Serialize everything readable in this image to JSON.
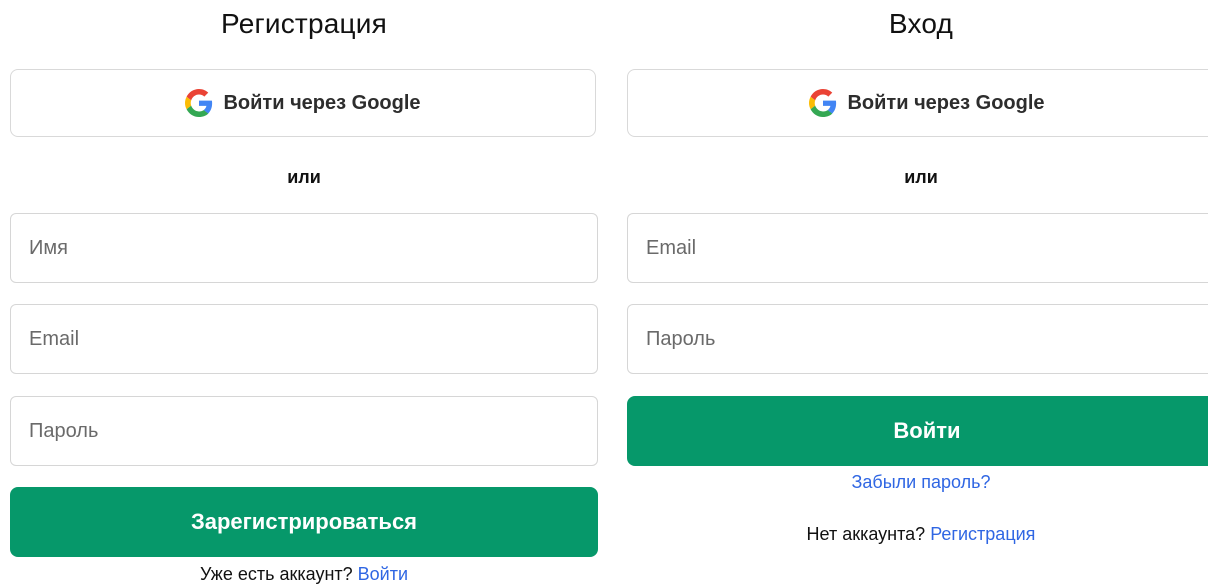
{
  "register": {
    "title": "Регистрация",
    "google_label": "Войти через Google",
    "or_label": "или",
    "fields": {
      "name": {
        "placeholder": "Имя"
      },
      "email": {
        "placeholder": "Email"
      },
      "password": {
        "placeholder": "Пароль"
      }
    },
    "submit_label": "Зарегистрироваться",
    "footer_text": "Уже есть аккаунт?",
    "footer_link": "Войти"
  },
  "login": {
    "title": "Вход",
    "google_label": "Войти через Google",
    "or_label": "или",
    "fields": {
      "email": {
        "placeholder": "Email"
      },
      "password": {
        "placeholder": "Пароль"
      }
    },
    "submit_label": "Войти",
    "forgot_link": "Забыли пароль?",
    "footer_text": "Нет аккаунта?",
    "footer_link": "Регистрация"
  },
  "colors": {
    "primary": "#06986a",
    "link": "#2f66e3",
    "border": "#d9d9d9"
  },
  "icons": {
    "google": "google-logo-icon"
  }
}
